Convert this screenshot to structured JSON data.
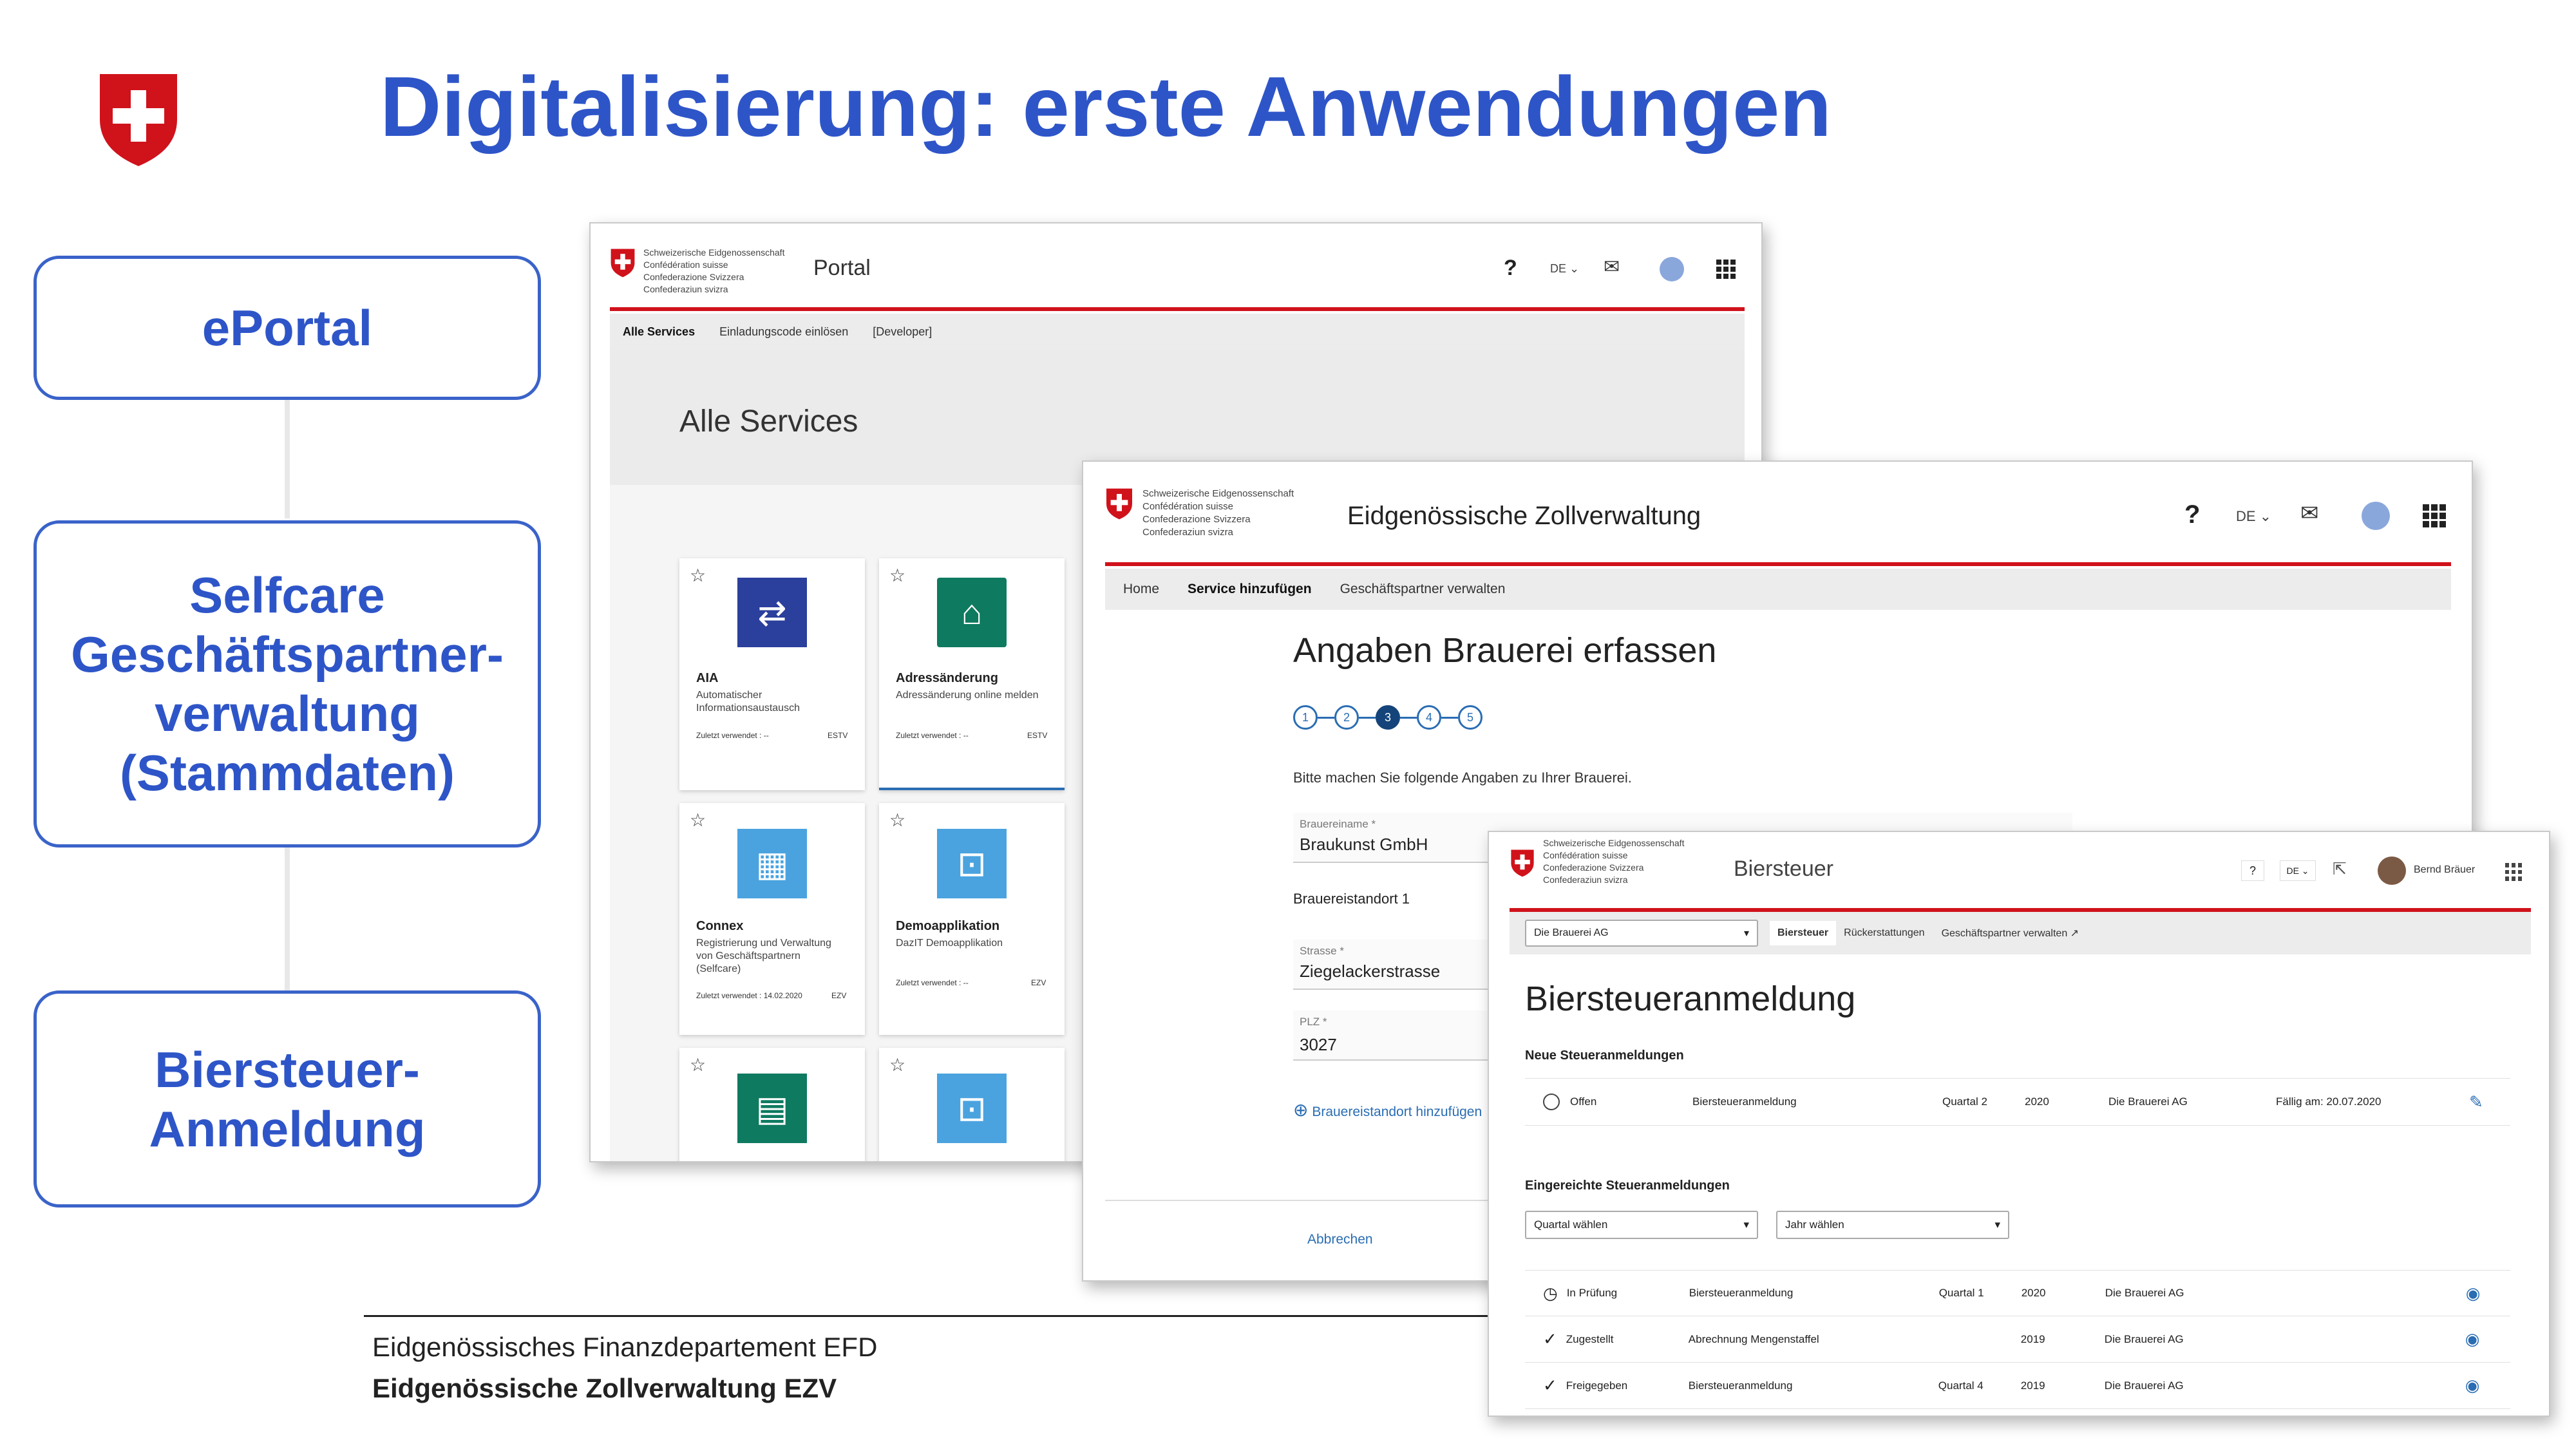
{
  "slide": {
    "title": "Digitalisierung: erste Anwendungen",
    "left_boxes": [
      "ePortal",
      "Selfcare\nGeschäftspartner-\nverwaltung\n(Stammdaten)",
      "Biersteuer-\nAnmeldung"
    ],
    "footer_line1": "Eidgenössisches Finanzdepartement EFD",
    "footer_line2": "Eidgenössische Zollverwaltung EZV",
    "colors": {
      "title": "#2e55c8",
      "swiss_red": "#d0121b",
      "primary_blue": "#2a6db3"
    }
  },
  "confederation": "Schweizerische Eidgenossenschaft\nConfédération suisse\nConfederazione Svizzera\nConfederaziun svizra",
  "portal": {
    "app_title": "Portal",
    "help": "?",
    "language": "DE",
    "tabs": [
      "Alle Services",
      "Einladungscode einlösen",
      "[Developer]"
    ],
    "page_title": "Alle Services",
    "cards": [
      {
        "name": "AIA",
        "desc": "Automatischer\nInformationsaustausch",
        "last_used": "Zuletzt verwendet : --",
        "org": "ESTV",
        "icon": "exchange-arrows-icon",
        "color": "#2b3f9c"
      },
      {
        "name": "Adressänderung",
        "desc": "Adressänderung online melden",
        "last_used": "Zuletzt verwendet : --",
        "org": "ESTV",
        "icon": "location-pin-icon",
        "color": "#0e7a5f"
      },
      {
        "name": "Connex",
        "desc": "Registrierung und Verwaltung\nvon Geschäftspartnern\n(Selfcare)",
        "last_used": "Zuletzt verwendet : 14.02.2020",
        "org": "EZV",
        "icon": "business-partner-icon",
        "color": "#4aa3df"
      },
      {
        "name": "Demoapplikation",
        "desc": "DazIT Demoapplikation",
        "last_used": "Zuletzt verwendet : --",
        "org": "EZV",
        "icon": "package-check-icon",
        "color": "#4aa3df"
      },
      {
        "name": "",
        "desc": "",
        "last_used": "",
        "org": "",
        "icon": "calendar-clock-icon",
        "color": "#0e7a5f"
      },
      {
        "name": "",
        "desc": "",
        "last_used": "",
        "org": "",
        "icon": "package-check-icon",
        "color": "#4aa3df"
      }
    ]
  },
  "zoll": {
    "app_title": "Eidgenössische Zollverwaltung",
    "help": "?",
    "language": "DE",
    "tabs": [
      "Home",
      "Service hinzufügen",
      "Geschäftspartner verwalten"
    ],
    "page_title": "Angaben Brauerei erfassen",
    "steps": [
      "1",
      "2",
      "3",
      "4",
      "5"
    ],
    "current_step": 3,
    "intro": "Bitte machen Sie folgende Angaben zu Ihrer Brauerei.",
    "brauereiname_label": "Brauereiname *",
    "brauereiname_value": "Braukunst GmbH",
    "standort_heading": "Brauereistandort 1",
    "strasse_label": "Strasse *",
    "strasse_value": "Ziegelackerstrasse",
    "plz_label": "PLZ *",
    "plz_value": "3027",
    "add_location": "Brauereistandort hinzufügen",
    "cancel": "Abbrechen"
  },
  "bier": {
    "app_title": "Biersteuer",
    "help": "?",
    "language": "DE",
    "user": "Bernd Bräuer",
    "company_select": "Die Brauerei AG",
    "tabs": [
      "Biersteuer",
      "Rückerstattungen",
      "Geschäftspartner verwalten"
    ],
    "page_title": "Biersteueranmeldung",
    "new_heading": "Neue Steueranmeldungen",
    "new_rows": [
      {
        "status": "Offen",
        "type": "Biersteueranmeldung",
        "quarter": "Quartal 2",
        "year": "2020",
        "company": "Die Brauerei AG",
        "due": "Fällig am: 20.07.2020",
        "icon": "edit-pencil-icon"
      }
    ],
    "submitted_heading": "Eingereichte Steueranmeldungen",
    "quarter_select": "Quartal wählen",
    "year_select": "Jahr wählen",
    "submitted_rows": [
      {
        "status": "In Prüfung",
        "type": "Biersteueranmeldung",
        "quarter": "Quartal 1",
        "year": "2020",
        "company": "Die Brauerei AG",
        "status_icon": "clock-icon"
      },
      {
        "status": "Zugestellt",
        "type": "Abrechnung Mengenstaffel",
        "quarter": "",
        "year": "2019",
        "company": "Die Brauerei AG",
        "status_icon": "check-circle-icon"
      },
      {
        "status": "Freigegeben",
        "type": "Biersteueranmeldung",
        "quarter": "Quartal 4",
        "year": "2019",
        "company": "Die Brauerei AG",
        "status_icon": "check-circle-icon"
      }
    ]
  }
}
